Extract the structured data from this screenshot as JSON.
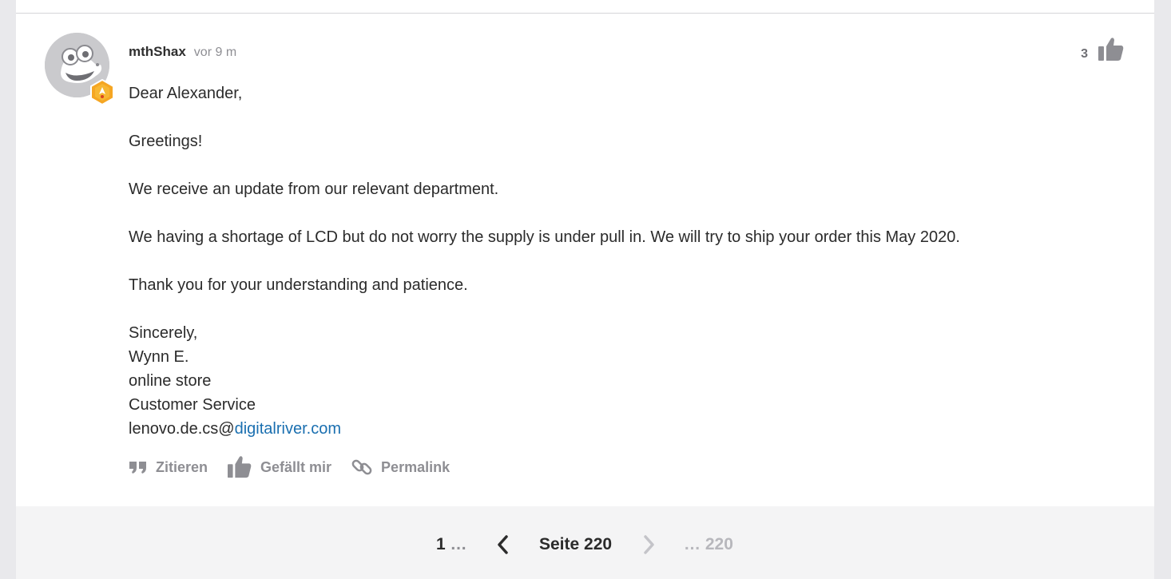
{
  "post": {
    "username": "mthShax",
    "time": "vor 9 m",
    "like_count": "3",
    "body": {
      "greeting": "Dear Alexander,",
      "line1": "Greetings!",
      "line2": "We receive an update from our relevant department.",
      "line3": "We having a shortage of LCD but do not worry the supply is under pull in. We will try to ship your order this May 2020.",
      "line4": "Thank you for your understanding and patience.",
      "sign_off": "Sincerely,",
      "signer": "Wynn E.",
      "dept1": "online store",
      "dept2": "Customer Service",
      "email_prefix": "lenovo.de.cs@",
      "email_link": "digitalriver.com"
    },
    "actions": {
      "quote": "Zitieren",
      "like": "Gefällt mir",
      "permalink": "Permalink"
    }
  },
  "pagination": {
    "first": "1",
    "first_dots": "…",
    "current": "Seite 220",
    "last_dots": "…",
    "last": "220"
  },
  "colors": {
    "link": "#1a6fb0",
    "muted": "#8e8e93",
    "badge": "#f5a623"
  },
  "icons": {
    "avatar": "cartoon-crocodile-avatar",
    "rank_badge": "rank-badge-icon",
    "like": "thumbs-up-icon",
    "quote": "quote-icon",
    "permalink": "link-icon",
    "prev": "chevron-left-icon",
    "next": "chevron-right-icon"
  }
}
